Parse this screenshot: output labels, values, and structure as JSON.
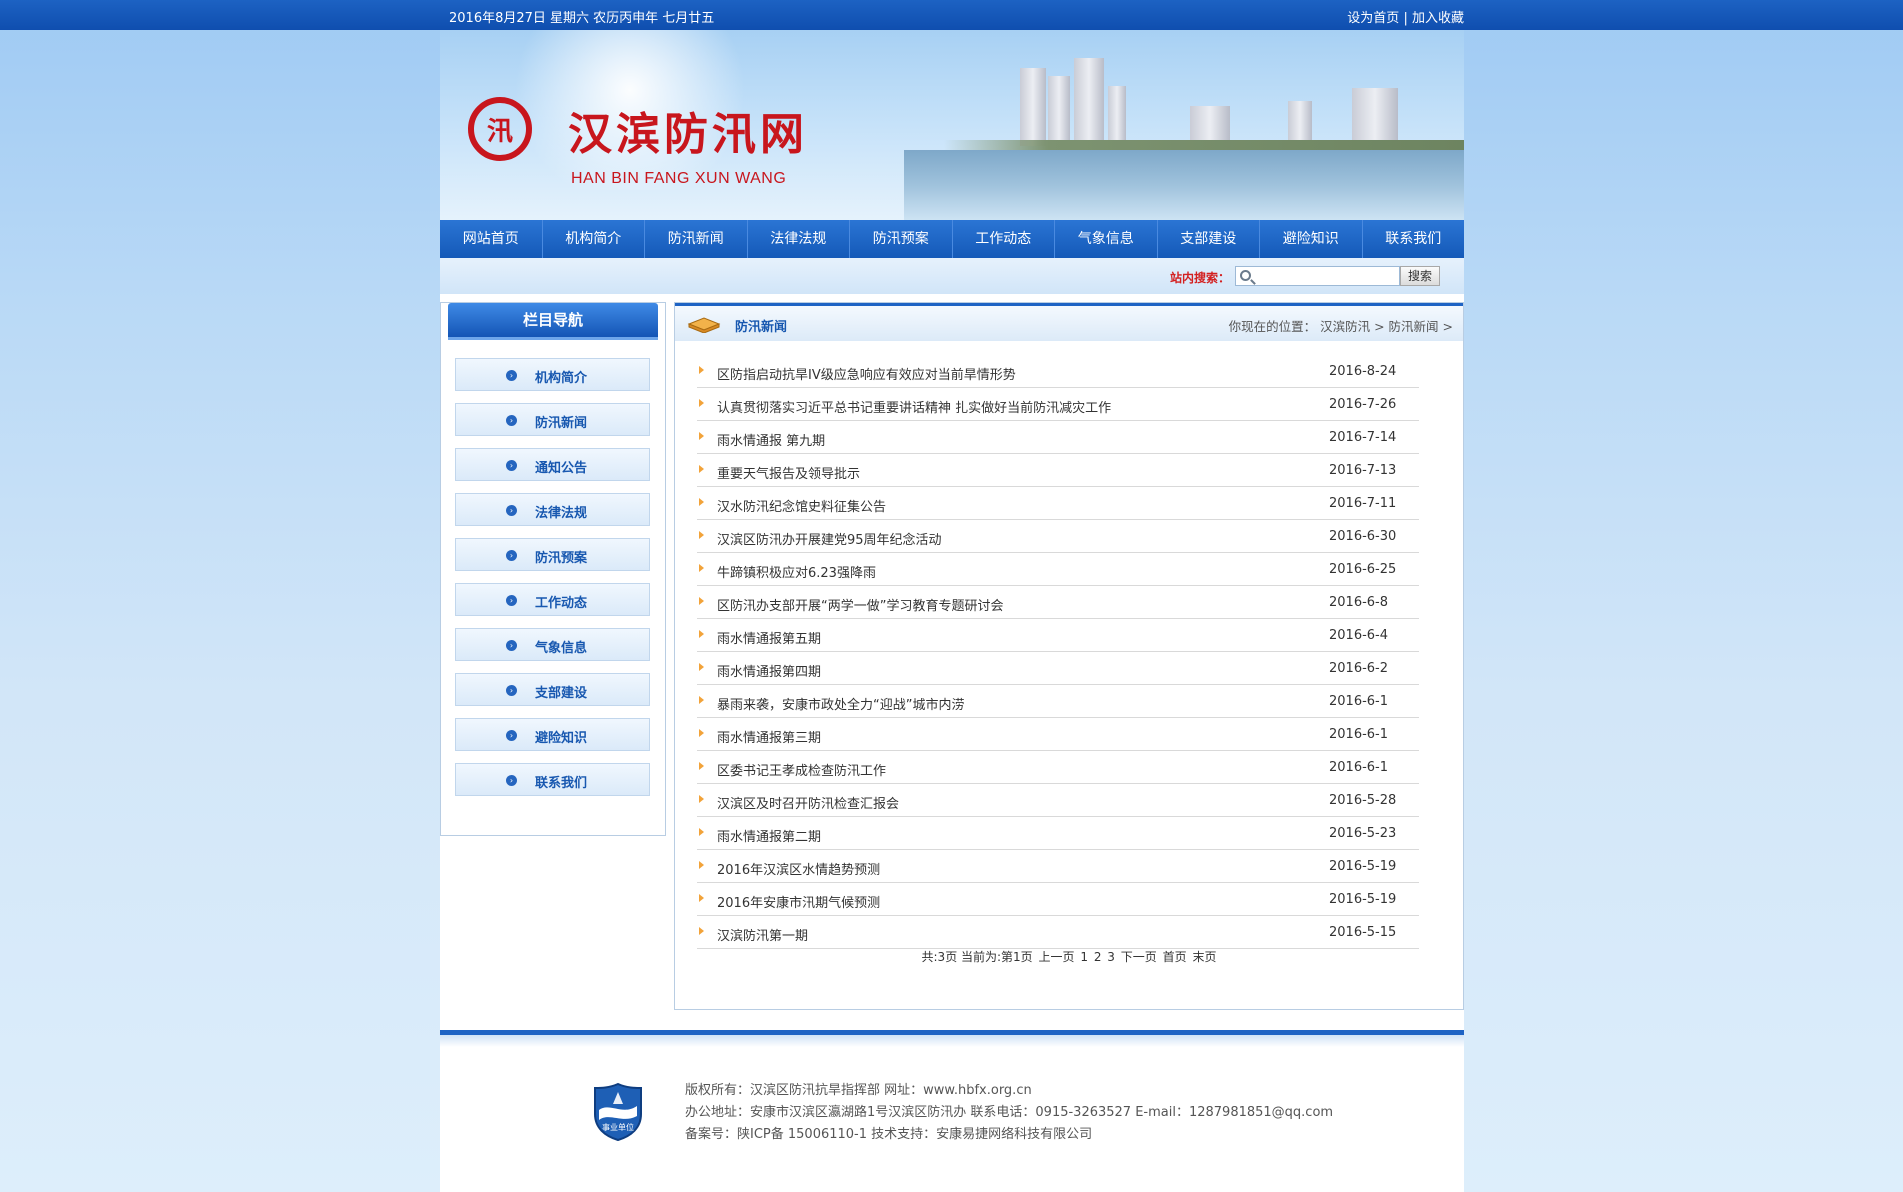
{
  "topbar": {
    "date": "2016年8月27日 星期六 农历丙申年 七月廿五",
    "set_home": "设为首页",
    "separator": "|",
    "add_fav": "加入收藏"
  },
  "logo": {
    "mark": "汛",
    "title": "汉滨防汛网",
    "subtitle": "HAN BIN FANG XUN WANG"
  },
  "nav": [
    "网站首页",
    "机构简介",
    "防汛新闻",
    "法律法规",
    "防汛预案",
    "工作动态",
    "气象信息",
    "支部建设",
    "避险知识",
    "联系我们"
  ],
  "search": {
    "label": "站内搜索：",
    "placeholder": "",
    "button": "搜索"
  },
  "sidebar": {
    "title": "栏目导航",
    "items": [
      "机构简介",
      "防汛新闻",
      "通知公告",
      "法律法规",
      "防汛预案",
      "工作动态",
      "气象信息",
      "支部建设",
      "避险知识",
      "联系我们"
    ]
  },
  "main": {
    "title": "防汛新闻",
    "breadcrumb": "你现在的位置： 汉滨防汛 > 防汛新闻 >",
    "news": [
      {
        "title": "区防指启动抗旱IV级应急响应有效应对当前旱情形势",
        "date": "2016-8-24"
      },
      {
        "title": "认真贯彻落实习近平总书记重要讲话精神 扎实做好当前防汛减灾工作",
        "date": "2016-7-26"
      },
      {
        "title": "雨水情通报 第九期",
        "date": "2016-7-14"
      },
      {
        "title": "重要天气报告及领导批示",
        "date": "2016-7-13"
      },
      {
        "title": "汉水防汛纪念馆史料征集公告",
        "date": "2016-7-11"
      },
      {
        "title": "汉滨区防汛办开展建党95周年纪念活动",
        "date": "2016-6-30"
      },
      {
        "title": "牛蹄镇积极应对6.23强降雨",
        "date": "2016-6-25"
      },
      {
        "title": "区防汛办支部开展“两学一做”学习教育专题研讨会",
        "date": "2016-6-8"
      },
      {
        "title": "雨水情通报第五期",
        "date": "2016-6-4"
      },
      {
        "title": "雨水情通报第四期",
        "date": "2016-6-2"
      },
      {
        "title": "暴雨来袭，安康市政处全力“迎战”城市内涝",
        "date": "2016-6-1"
      },
      {
        "title": "雨水情通报第三期",
        "date": "2016-6-1"
      },
      {
        "title": "区委书记王孝成检查防汛工作",
        "date": "2016-6-1"
      },
      {
        "title": "汉滨区及时召开防汛检查汇报会",
        "date": "2016-5-28"
      },
      {
        "title": "雨水情通报第二期",
        "date": "2016-5-23"
      },
      {
        "title": "2016年汉滨区水情趋势预测",
        "date": "2016-5-19"
      },
      {
        "title": "2016年安康市汛期气候预测",
        "date": "2016-5-19"
      },
      {
        "title": "汉滨防汛第一期",
        "date": "2016-5-15"
      }
    ],
    "pager": {
      "summary": "共:3页 当前为:第1页",
      "prev": "上一页",
      "pages": [
        "1",
        "2",
        "3"
      ],
      "next": "下一页",
      "first": "首页",
      "last": "末页"
    }
  },
  "footer": {
    "badge_text": "事业单位",
    "copyright": "版权所有：汉滨区防汛抗旱指挥部 网址：www.hbfx.org.cn",
    "address": "办公地址：安康市汉滨区瀛湖路1号汉滨区防汛办  联系电话：0915-3263527  E-mail：1287981851@qq.com",
    "icp": "备案号：陕ICP备 15006110-1  技术支持：安康易捷网络科技有限公司"
  },
  "colors": {
    "brand_blue": "#1459b8",
    "logo_red": "#c8161d",
    "search_label_red": "#d32020",
    "arrow_orange": "#f2a33a"
  },
  "icons": [
    "search-icon",
    "book-icon",
    "arrow-bullet-icon",
    "nav-circle-icon",
    "public-institution-badge-icon"
  ]
}
